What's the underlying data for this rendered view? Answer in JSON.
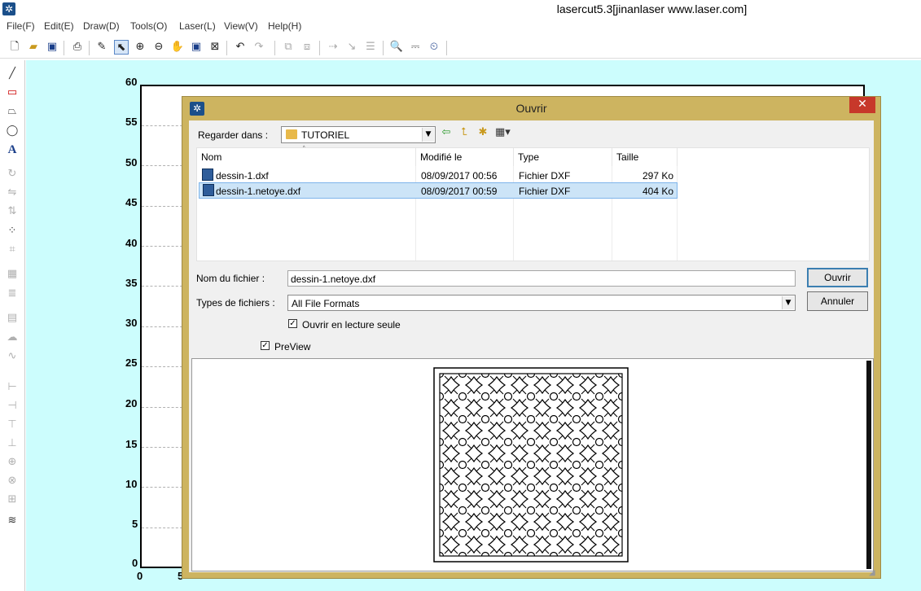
{
  "app": {
    "title": "lasercut5.3[jinanlaser www.laser.com]",
    "menu": [
      "File(F)",
      "Edit(E)",
      "Draw(D)",
      "Tools(O)",
      "Laser(L)",
      "View(V)",
      "Help(H)"
    ]
  },
  "ruler": {
    "y_labels": [
      "60",
      "55",
      "50",
      "45",
      "40",
      "35",
      "30",
      "25",
      "20",
      "15",
      "10",
      "5",
      "0"
    ],
    "x_labels": [
      "0",
      "5"
    ]
  },
  "colors": {
    "canvas_bg": "#ccfdfd",
    "dialog_frame": "#cdb460",
    "selection": "#cce4f7",
    "close_button": "#c7382a"
  },
  "dialog": {
    "title": "Ouvrir",
    "look_in_label": "Regarder dans :",
    "look_in_value": "TUTORIEL",
    "columns": [
      "Nom",
      "Modifié le",
      "Type",
      "Taille"
    ],
    "files": [
      {
        "name": "dessin-1.dxf",
        "modified": "08/09/2017 00:56",
        "type": "Fichier DXF",
        "size": "297 Ko",
        "selected": false
      },
      {
        "name": "dessin-1.netoye.dxf",
        "modified": "08/09/2017 00:59",
        "type": "Fichier DXF",
        "size": "404 Ko",
        "selected": true
      }
    ],
    "filename_label": "Nom du fichier :",
    "filename_value": "dessin-1.netoye.dxf",
    "filetype_label": "Types de fichiers :",
    "filetype_value": "All File Formats",
    "readonly_label": "Ouvrir en lecture seule",
    "readonly_checked": true,
    "preview_label": "PreView",
    "preview_checked": true,
    "open_button": "Ouvrir",
    "cancel_button": "Annuler"
  }
}
